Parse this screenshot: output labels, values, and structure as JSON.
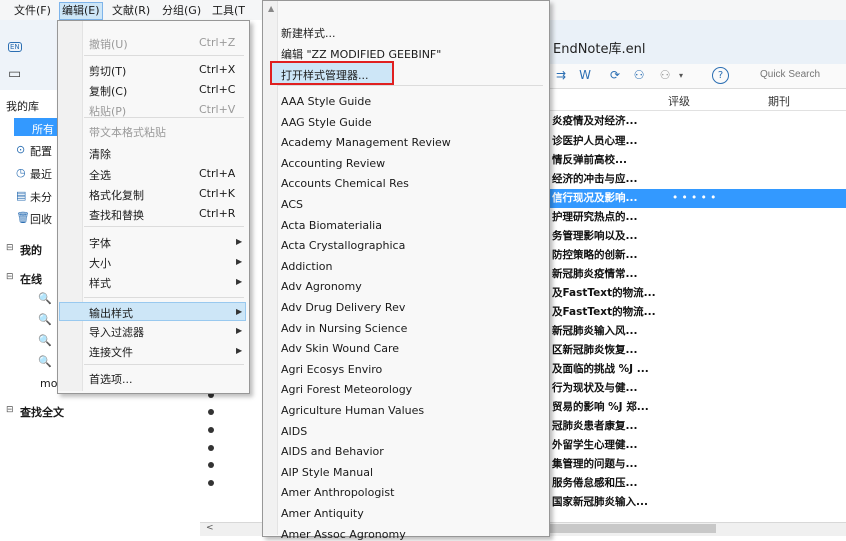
{
  "menubar": {
    "items": [
      "文件(F)",
      "编辑(E)",
      "文献(R)",
      "分组(G)",
      "工具(T"
    ]
  },
  "window": {
    "title": "EndNote库.enl"
  },
  "toolbar": {
    "quick_search": "Quick Search"
  },
  "columns": {
    "rating": "评级",
    "journal": "期刊"
  },
  "references": [
    "炎疫情及对经济...",
    "诊医护人员心理...",
    "情反弹前高校...",
    "经济的冲击与应...",
    "信行现况及影响...",
    "护理研究热点的...",
    "务管理影响以及...",
    "防控策略的创新...",
    "新冠肺炎疫情常...",
    "及FastText的物流...",
    "及FastText的物流...",
    "新冠肺炎输入风...",
    "区新冠肺炎恢复...",
    "及面临的挑战 %J ...",
    "行为现状及与健...",
    "贸易的影响 %J 郑...",
    "冠肺炎患者康复...",
    "外留学生心理健...",
    "集管理的问题与...",
    "服务倦怠感和压...",
    "国家新冠肺炎输入..."
  ],
  "selected_row_dots": "• • • • •",
  "left_panel": {
    "my_library": "我的库",
    "all": "所有",
    "configure": "配置",
    "recent": "最近",
    "unfiled": "未分",
    "trash": "回收",
    "my_groups": "我的",
    "online": "在线",
    "mo": "mo",
    "find_full_text": "查找全文"
  },
  "edit_menu": {
    "items": [
      {
        "label": "撤销(U)",
        "shortcut": "Ctrl+Z",
        "disabled": true
      },
      {
        "label": "剪切(T)",
        "shortcut": "Ctrl+X",
        "disabled": false
      },
      {
        "label": "复制(C)",
        "shortcut": "Ctrl+C",
        "disabled": false
      },
      {
        "label": "粘贴(P)",
        "shortcut": "Ctrl+V",
        "disabled": true
      },
      {
        "label": "带文本格式粘贴",
        "shortcut": "",
        "disabled": true
      },
      {
        "label": "清除",
        "shortcut": "",
        "disabled": false
      },
      {
        "label": "全选",
        "shortcut": "Ctrl+A",
        "disabled": false
      },
      {
        "label": "格式化复制",
        "shortcut": "Ctrl+K",
        "disabled": false
      },
      {
        "label": "查找和替换",
        "shortcut": "Ctrl+R",
        "disabled": false
      },
      {
        "label": "字体",
        "shortcut": "",
        "disabled": false
      },
      {
        "label": "大小",
        "shortcut": "",
        "disabled": false
      },
      {
        "label": "样式",
        "shortcut": "",
        "disabled": false
      },
      {
        "label": "输出样式",
        "shortcut": "",
        "disabled": false
      },
      {
        "label": "导入过滤器",
        "shortcut": "",
        "disabled": false
      },
      {
        "label": "连接文件",
        "shortcut": "",
        "disabled": false
      },
      {
        "label": "首选项...",
        "shortcut": "",
        "disabled": false
      }
    ]
  },
  "style_menu": {
    "new_style": "新建样式...",
    "edit_style": "编辑 \"ZZ MODIFIED GEEBINF\"",
    "open_manager": "打开样式管理器...",
    "styles": [
      "AAA Style Guide",
      "AAG Style Guide",
      "Academy Management Review",
      "Accounting Review",
      "Accounts Chemical Res",
      "ACS",
      "Acta Biomaterialia",
      "Acta Crystallographica",
      "Addiction",
      "Adv Agronomy",
      "Adv Drug Delivery Rev",
      "Adv in Nursing Science",
      "Adv Skin Wound Care",
      "Agri Ecosys Enviro",
      "Agri Forest Meteorology",
      "Agriculture Human Values",
      "AIDS",
      "AIDS and Behavior",
      "AIP Style Manual",
      "Amer Anthropologist",
      "Amer Antiquity",
      "Amer Assoc Agronomy"
    ]
  }
}
